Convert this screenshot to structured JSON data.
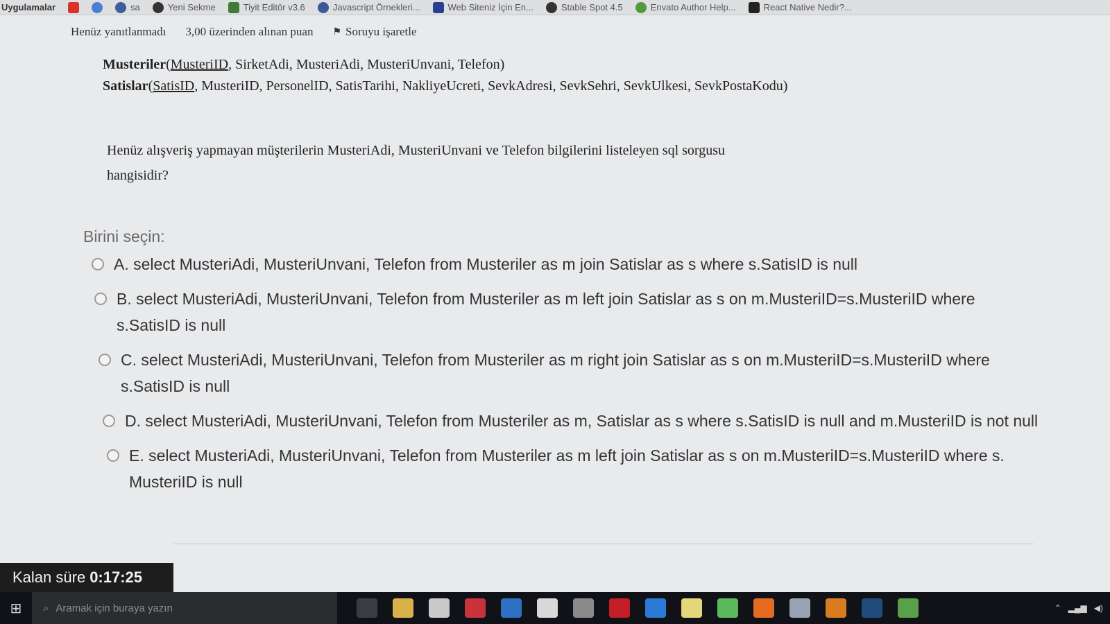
{
  "bookmarks": {
    "apps_label": "Uygulamalar",
    "items": [
      {
        "icon": "youtube-icon",
        "label": "",
        "color": "#d9332b"
      },
      {
        "icon": "google-icon",
        "label": "",
        "color": "#4a7fd6"
      },
      {
        "icon": "history-icon",
        "label": "sa",
        "color": "#3d5f9e"
      },
      {
        "icon": "github-icon",
        "label": "Yeni Sekme",
        "color": "#333333"
      },
      {
        "icon": "editor-icon",
        "label": "Tiyit Editör v3.6",
        "color": "#3f7a3a"
      },
      {
        "icon": "wordpress-icon",
        "label": "Javascript Örnekleri...",
        "color": "#3a5a9a"
      },
      {
        "icon": "bookmark-icon",
        "label": "Web Siteniz İçin En...",
        "color": "#2b3f8f"
      },
      {
        "icon": "github-icon",
        "label": "Stable Spot 4.5",
        "color": "#333333"
      },
      {
        "icon": "envato-icon",
        "label": "Envato Author Help...",
        "color": "#4f9a3b"
      },
      {
        "icon": "react-icon",
        "label": "React Native Nedir?...",
        "color": "#222222"
      }
    ]
  },
  "info": {
    "status": "Henüz yanıtlanmadı",
    "points": "3,00 üzerinden alınan puan",
    "flag_label": "Soruyu işaretle"
  },
  "schema": {
    "table1_name": "Musteriler",
    "table1_pk": "MusteriID",
    "table1_rest": ", SirketAdi, MusteriAdi, MusteriUnvani, Telefon)",
    "table2_name": "Satislar",
    "table2_pk": "SatisID",
    "table2_rest": ", MusteriID, PersonelID, SatisTarihi, NakliyeUcreti, SevkAdresi, SevkSehri, SevkUlkesi, SevkPostaKodu)"
  },
  "question": "Henüz alışveriş yapmayan müşterilerin MusteriAdi, MusteriUnvani ve Telefon bilgilerini listeleyen sql sorgusu hangisidir?",
  "choose_label": "Birini seçin:",
  "options": [
    {
      "text": "A. select MusteriAdi, MusteriUnvani, Telefon from Musteriler as m join Satislar as s where s.SatisID is null"
    },
    {
      "text": "B. select MusteriAdi, MusteriUnvani, Telefon from Musteriler as m left join Satislar as s on m.MusteriID=s.MusteriID where s.SatisID is null"
    },
    {
      "text": "C. select MusteriAdi, MusteriUnvani, Telefon from Musteriler as m right join Satislar as s on m.MusteriID=s.MusteriID where s.SatisID is null"
    },
    {
      "text": "D. select MusteriAdi, MusteriUnvani, Telefon from Musteriler as m, Satislar as s where s.SatisID is null and m.MusteriID is not null"
    },
    {
      "text": "E. select MusteriAdi, MusteriUnvani, Telefon from Musteriler as m left join Satislar as s on m.MusteriID=s.MusteriID where s. MusteriID is null"
    }
  ],
  "timer": {
    "label": "Kalan süre",
    "value": "0:17:25"
  },
  "taskbar": {
    "search_placeholder": "Aramak için buraya yazın",
    "icons": [
      {
        "name": "task-view-icon",
        "color": "#3a3d44"
      },
      {
        "name": "file-explorer-icon",
        "color": "#d9b04a"
      },
      {
        "name": "store-icon",
        "color": "#c9c9c9"
      },
      {
        "name": "calendar-app-icon",
        "color": "#c8333a"
      },
      {
        "name": "mail-icon",
        "color": "#2f6fc4"
      },
      {
        "name": "yandex-icon",
        "color": "#d8d8d8"
      },
      {
        "name": "tools-icon",
        "color": "#8a8a8a"
      },
      {
        "name": "opera-icon",
        "color": "#c41e27"
      },
      {
        "name": "edge-icon",
        "color": "#2b7bd6"
      },
      {
        "name": "notes-icon",
        "color": "#e6d67a"
      },
      {
        "name": "app-green-icon",
        "color": "#5cb85c"
      },
      {
        "name": "firefox-icon",
        "color": "#e66a1f"
      },
      {
        "name": "shield-app-icon",
        "color": "#9aa3b5"
      },
      {
        "name": "sublime-icon",
        "color": "#d97b1f"
      },
      {
        "name": "photoshop-icon",
        "color": "#1f4c7a"
      },
      {
        "name": "chrome-icon",
        "color": "#5aa04a"
      }
    ]
  }
}
